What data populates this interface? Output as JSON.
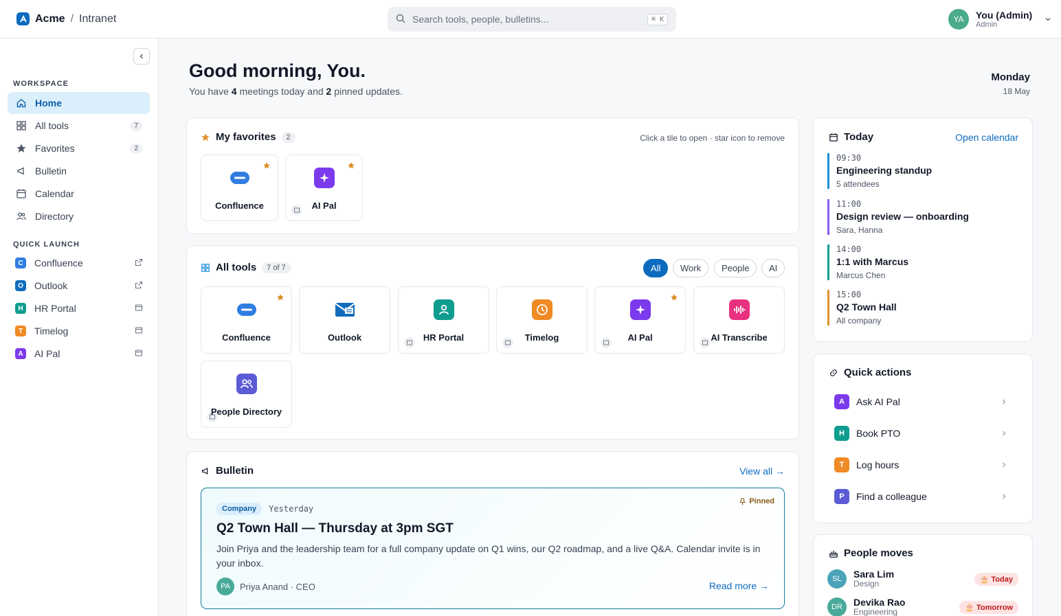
{
  "topbar": {
    "brand": "Acme",
    "separator": "/",
    "subtitle": "Intranet",
    "search_placeholder": "Search tools, people, bulletins...",
    "shortcut": "⌘ K",
    "user_initials": "YA",
    "user_name": "You (Admin)",
    "user_role": "Admin"
  },
  "sidebar": {
    "workspace_heading": "WORKSPACE",
    "items": [
      {
        "label": "Home",
        "count": ""
      },
      {
        "label": "All tools",
        "count": "7"
      },
      {
        "label": "Favorites",
        "count": "2"
      },
      {
        "label": "Bulletin",
        "count": ""
      },
      {
        "label": "Calendar",
        "count": ""
      },
      {
        "label": "Directory",
        "count": ""
      }
    ],
    "quick_heading": "QUICK LAUNCH",
    "quick": [
      {
        "letter": "C",
        "label": "Confluence",
        "color": "#2f7de1"
      },
      {
        "letter": "O",
        "label": "Outlook",
        "color": "#0f6cbd"
      },
      {
        "letter": "H",
        "label": "HR Portal",
        "color": "#0f9d8f"
      },
      {
        "letter": "T",
        "label": "Timelog",
        "color": "#f08a24"
      },
      {
        "letter": "A",
        "label": "AI Pal",
        "color": "#7c3aed"
      }
    ]
  },
  "greeting": {
    "title": "Good morning, You.",
    "pre": "You have ",
    "meetings": "4",
    "mid": " meetings today and ",
    "pinned": "2",
    "post": " pinned updates.",
    "day": "Monday",
    "date": "18 May"
  },
  "favorites": {
    "title": "My favorites",
    "count": "2",
    "hint": "Click a tile to open · star icon to remove",
    "tiles": [
      "Confluence",
      "AI Pal"
    ]
  },
  "tools": {
    "title": "All tools",
    "count": "7 of 7",
    "filters": [
      "All",
      "Work",
      "People",
      "AI"
    ],
    "tiles": [
      "Confluence",
      "Outlook",
      "HR Portal",
      "Timelog",
      "AI Pal",
      "AI Transcribe",
      "People Directory"
    ]
  },
  "bulletin": {
    "title": "Bulletin",
    "view_all": "View all →",
    "category": "Company",
    "when": "Yesterday",
    "pinned": "Pinned",
    "headline": "Q2 Town Hall — Thursday at 3pm SGT",
    "body": "Join Priya and the leadership team for a full company update on Q1 wins, our Q2 roadmap, and a live Q&A. Calendar invite is in your inbox.",
    "author_initials": "PA",
    "author": "Priya Anand · CEO",
    "read_more": "Read more →"
  },
  "today": {
    "title": "Today",
    "open": "Open calendar",
    "events": [
      {
        "time": "09:30",
        "name": "Engineering standup",
        "detail": "5 attendees",
        "color": "#1d8fd8"
      },
      {
        "time": "11:00",
        "name": "Design review — onboarding",
        "detail": "Sara, Hanna",
        "color": "#8b5cf6"
      },
      {
        "time": "14:00",
        "name": "1:1 with Marcus",
        "detail": "Marcus Chen",
        "color": "#0f9d8f"
      },
      {
        "time": "15:00",
        "name": "Q2 Town Hall",
        "detail": "All company",
        "color": "#e0912f"
      }
    ]
  },
  "quick_actions": {
    "title": "Quick actions",
    "items": [
      {
        "letter": "A",
        "label": "Ask AI Pal",
        "color": "#7c3aed"
      },
      {
        "letter": "H",
        "label": "Book PTO",
        "color": "#0f9d8f"
      },
      {
        "letter": "T",
        "label": "Log hours",
        "color": "#f08a24"
      },
      {
        "letter": "P",
        "label": "Find a colleague",
        "color": "#5b5bd6"
      }
    ]
  },
  "people": {
    "title": "People moves",
    "items": [
      {
        "initials": "SL",
        "name": "Sara Lim",
        "dept": "Design",
        "tag": "🎂 Today",
        "color": "#4aa3b8"
      },
      {
        "initials": "DR",
        "name": "Devika Rao",
        "dept": "Engineering",
        "tag": "🎂 Tomorrow",
        "color": "#4aaa9a"
      }
    ]
  }
}
